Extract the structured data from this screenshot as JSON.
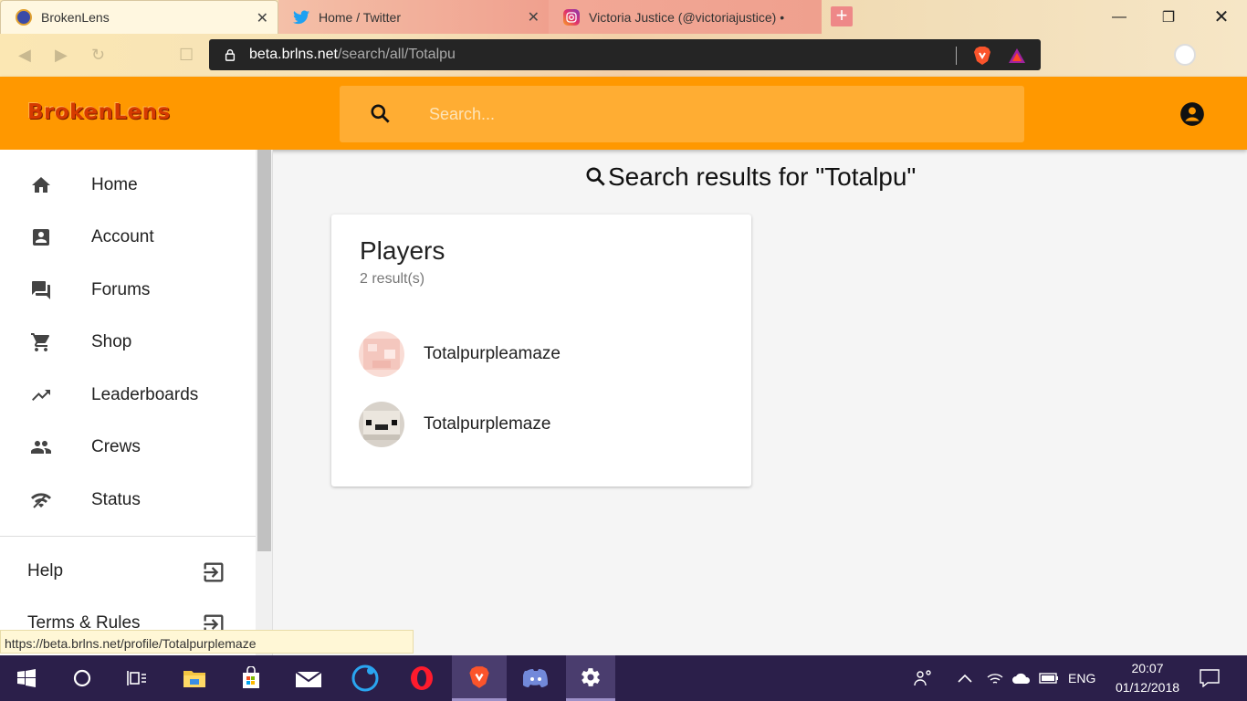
{
  "browser": {
    "tabs": [
      {
        "title": "BrokenLens",
        "icon": "brokenlens-favicon",
        "active": true
      },
      {
        "title": "Home / Twitter",
        "icon": "twitter-icon",
        "active": false
      },
      {
        "title": "Victoria Justice (@victoriajustice) •",
        "icon": "instagram-icon",
        "active": false
      }
    ],
    "url_host": "beta.brlns.net",
    "url_path": "/search/all/Totalpu",
    "status_url": "https://beta.brlns.net/profile/Totalpurplemaze"
  },
  "app": {
    "logo": "BrokenLens",
    "search_placeholder": "Search...",
    "accent": "#ff9800"
  },
  "sidebar": {
    "items": [
      {
        "label": "Home",
        "icon": "home-icon"
      },
      {
        "label": "Account",
        "icon": "account-box-icon"
      },
      {
        "label": "Forums",
        "icon": "forum-icon"
      },
      {
        "label": "Shop",
        "icon": "cart-icon"
      },
      {
        "label": "Leaderboards",
        "icon": "trending-up-icon"
      },
      {
        "label": "Crews",
        "icon": "people-icon"
      },
      {
        "label": "Status",
        "icon": "signal-icon"
      }
    ],
    "secondary": [
      {
        "label": "Help",
        "icon": "exit-to-app-icon"
      },
      {
        "label": "Terms & Rules",
        "icon": "exit-to-app-icon"
      }
    ]
  },
  "main": {
    "title": "Search results for \"Totalpu\"",
    "card": {
      "title": "Players",
      "subtitle": "2 result(s)",
      "players": [
        {
          "name": "Totalpurpleamaze"
        },
        {
          "name": "Totalpurplemaze"
        }
      ]
    }
  },
  "taskbar": {
    "language": "ENG",
    "time": "20:07",
    "date": "01/12/2018"
  }
}
